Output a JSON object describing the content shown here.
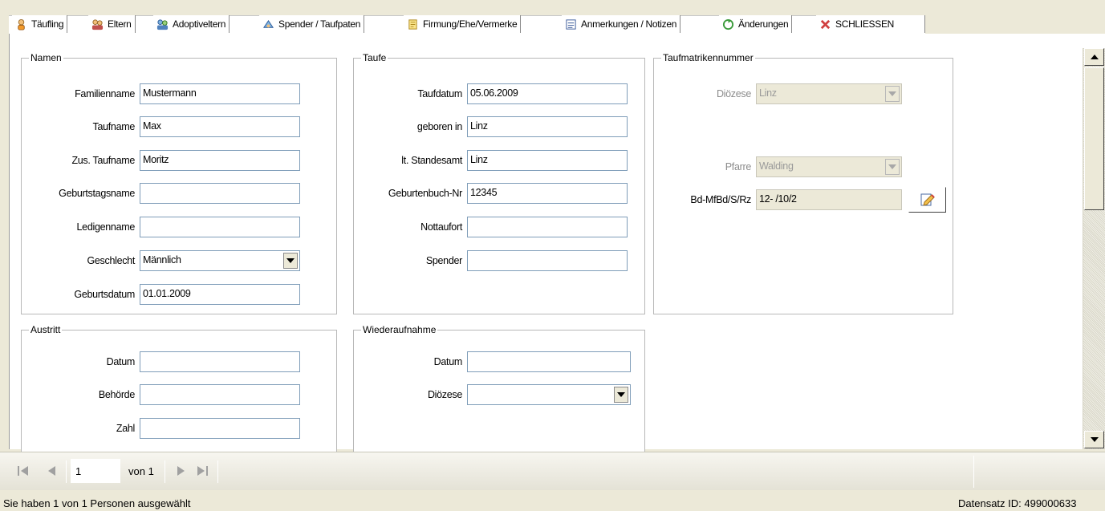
{
  "tabs": [
    {
      "label": "Täufling",
      "icon": "baby-icon",
      "active": true
    },
    {
      "label": "Eltern",
      "icon": "parents-icon"
    },
    {
      "label": "Adoptiveltern",
      "icon": "adoptive-parents-icon"
    },
    {
      "label": "Spender / Taufpaten",
      "icon": "godparents-icon"
    },
    {
      "label": "Firmung/Ehe/Vermerke",
      "icon": "notes-icon"
    },
    {
      "label": "Anmerkungen / Notizen",
      "icon": "notepad-icon"
    },
    {
      "label": "Änderungen",
      "icon": "changes-icon"
    },
    {
      "label": "SCHLIESSEN",
      "icon": "close-icon"
    }
  ],
  "namen": {
    "legend": "Namen",
    "fields": [
      {
        "label": "Familienname",
        "value": "Mustermann"
      },
      {
        "label": "Taufname",
        "value": "Max"
      },
      {
        "label": "Zus. Taufname",
        "value": "Moritz"
      },
      {
        "label": "Geburtstagsname",
        "value": ""
      },
      {
        "label": "Ledigenname",
        "value": ""
      },
      {
        "label": "Geschlecht",
        "value": "Männlich"
      },
      {
        "label": "Geburtsdatum",
        "value": "01.01.2009"
      }
    ]
  },
  "taufe": {
    "legend": "Taufe",
    "fields": [
      {
        "label": "Taufdatum",
        "value": "05.06.2009"
      },
      {
        "label": "geboren in",
        "value": "Linz"
      },
      {
        "label": "lt. Standesamt",
        "value": "Linz"
      },
      {
        "label": "Geburtenbuch-Nr",
        "value": "12345"
      },
      {
        "label": "Nottaufort",
        "value": ""
      },
      {
        "label": "Spender",
        "value": ""
      }
    ]
  },
  "taufmatrikel": {
    "legend": "Taufmatrikennummer",
    "dioezese_label": "Diözese",
    "dioezese_value": "Linz",
    "pfarre_label": "Pfarre",
    "pfarre_value": "Walding",
    "bd_label": "Bd-MfBd/S/Rz",
    "bd_value": "12- /10/2"
  },
  "austritt": {
    "legend": "Austritt",
    "fields": [
      {
        "label": "Datum",
        "value": ""
      },
      {
        "label": "Behörde",
        "value": ""
      },
      {
        "label": "Zahl",
        "value": ""
      }
    ]
  },
  "wiederaufnahme": {
    "legend": "Wiederaufnahme",
    "datum_label": "Datum",
    "datum_value": "",
    "dioezese_label": "Diözese",
    "dioezese_value": ""
  },
  "nav": {
    "position": "1",
    "of_label": "von 1"
  },
  "status": {
    "left": "Sie haben 1 von 1 Personen ausgewählt",
    "right": "Datensatz ID:  499000633"
  }
}
